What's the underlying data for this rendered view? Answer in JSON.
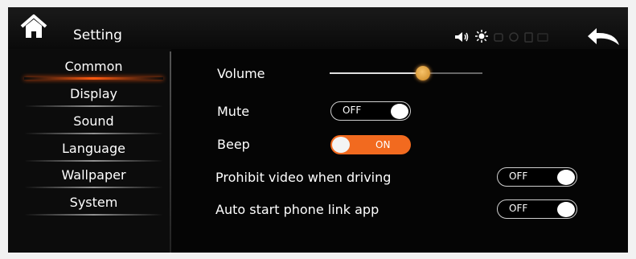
{
  "header": {
    "title": "Setting",
    "status_icons": [
      "speaker-icon",
      "brightness-icon",
      "dim-status-icons"
    ]
  },
  "sidebar": {
    "items": [
      {
        "label": "Common",
        "active": true
      },
      {
        "label": "Display",
        "active": false
      },
      {
        "label": "Sound",
        "active": false
      },
      {
        "label": "Language",
        "active": false
      },
      {
        "label": "Wallpaper",
        "active": false
      },
      {
        "label": "System",
        "active": false
      }
    ]
  },
  "settings": {
    "volume": {
      "label": "Volume",
      "level": 0.61
    },
    "mute": {
      "label": "Mute",
      "state": "OFF"
    },
    "beep": {
      "label": "Beep",
      "state": "ON"
    },
    "prohibit_video": {
      "label": "Prohibit video when driving",
      "state": "OFF"
    },
    "auto_start_phone": {
      "label": "Auto start phone link app",
      "state": "OFF"
    }
  },
  "colors": {
    "accent": "#f26a1f",
    "active_tab_line": "#ff5a10",
    "background": "#050505",
    "text": "#ffffff"
  }
}
